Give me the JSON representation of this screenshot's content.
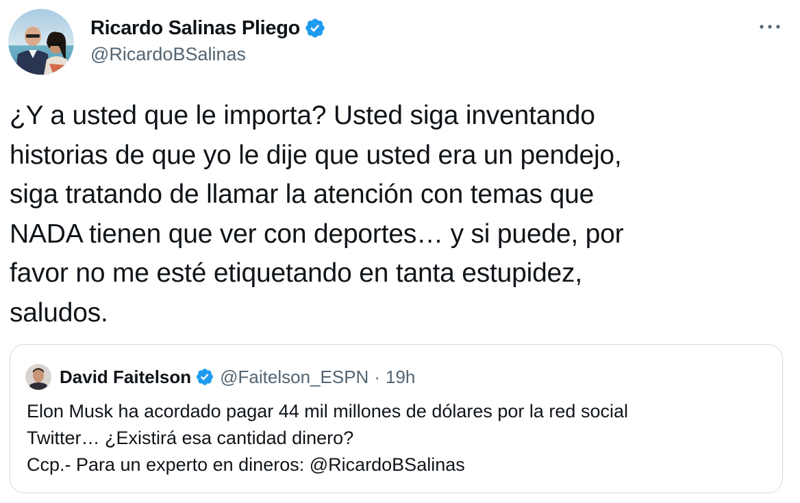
{
  "tweet": {
    "author": {
      "name": "Ricardo Salinas Pliego",
      "handle": "@RicardoBSalinas",
      "verified": true
    },
    "text": "¿Y a usted que le importa? Usted siga inventando\nhistorias de que yo le dije que usted era un pendejo,\nsiga tratando de llamar la atención con temas que\nNADA tienen que ver con deportes… y si puede, por\nfavor no me esté etiquetando en tanta estupidez,\nsaludos.",
    "quoted": {
      "name": "David Faitelson",
      "handle": "@Faitelson_ESPN",
      "separator": "·",
      "time": "19h",
      "verified": true,
      "text": "Elon Musk ha acordado pagar 44 mil millones de dólares por la red social\nTwitter… ¿Existirá esa cantidad dinero?\nCcp.- Para un experto en dineros: @RicardoBSalinas"
    }
  },
  "icons": {
    "verified": "verified-badge-icon",
    "more": "more-options-icon"
  },
  "colors": {
    "verified_blue": "#1d9bf0",
    "text_primary": "#0f1419",
    "text_secondary": "#536471",
    "border": "#cfd9de"
  }
}
